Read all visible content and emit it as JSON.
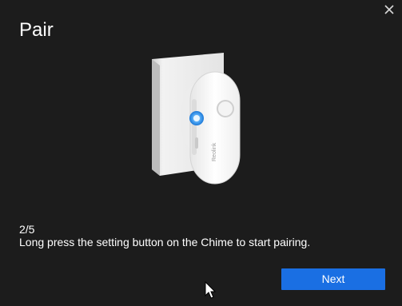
{
  "dialog": {
    "title": "Pair",
    "step": "2/5",
    "instruction": "Long press the setting button on the Chime to start pairing.",
    "next_label": "Next"
  },
  "product": {
    "brand": "Reolink"
  },
  "icons": {
    "close": "close-icon",
    "cursor": "mouse-pointer-icon"
  },
  "colors": {
    "background": "#1c1c1c",
    "text": "#ffffff",
    "primary_button": "#1a6fe3",
    "indicator_light": "#4aa3f2"
  }
}
